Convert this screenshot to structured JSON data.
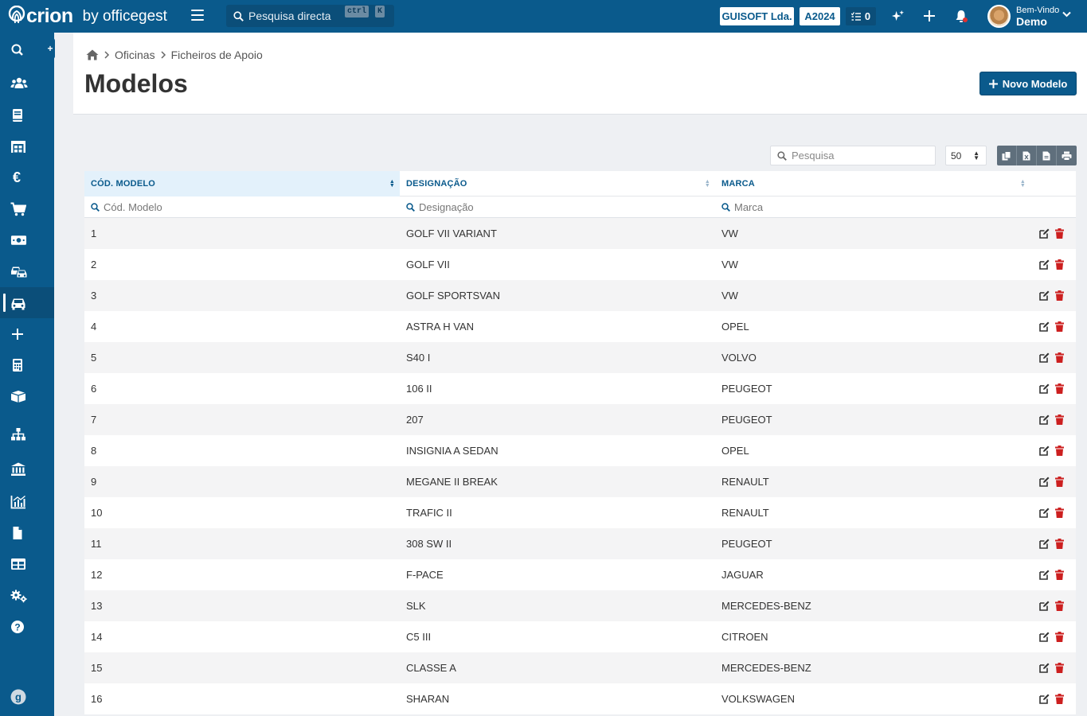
{
  "topbar": {
    "logo_text": "crion",
    "logo_by": "by officegest",
    "search_placeholder": "Pesquisa directa",
    "kbd_ctrl": "ctrl",
    "kbd_k": "K",
    "company": "GUISOFT Lda.",
    "year": "A2024",
    "tasks_count": "0",
    "greeting": "Bem-Vindo",
    "username": "Demo"
  },
  "sidebar": {
    "items": [
      {
        "icon": "search-icon"
      },
      {
        "icon": "users-icon"
      },
      {
        "icon": "book-icon"
      },
      {
        "icon": "warehouse-icon"
      },
      {
        "icon": "euro-icon"
      },
      {
        "icon": "cart-icon"
      },
      {
        "icon": "money-icon"
      },
      {
        "icon": "cars-icon"
      },
      {
        "icon": "car-icon",
        "active": true
      },
      {
        "icon": "plus-icon"
      },
      {
        "icon": "calculator-icon"
      },
      {
        "icon": "box-icon"
      },
      {
        "icon": "sitemap-icon"
      },
      {
        "icon": "bank-icon"
      },
      {
        "icon": "chart-icon"
      },
      {
        "icon": "file-icon"
      },
      {
        "icon": "table-icon"
      },
      {
        "icon": "cogs-icon"
      },
      {
        "icon": "help-icon"
      },
      {
        "icon": "officegest-icon"
      }
    ]
  },
  "breadcrumb": {
    "items": [
      "Oficinas",
      "Ficheiros de Apoio"
    ]
  },
  "page": {
    "title": "Modelos",
    "new_button": "Novo Modelo"
  },
  "tools": {
    "search_placeholder": "Pesquisa",
    "per_page": "50"
  },
  "table": {
    "columns": [
      "CÓD. MODELO",
      "DESIGNAÇÃO",
      "MARCA"
    ],
    "filters": [
      "Cód. Modelo",
      "Designação",
      "Marca"
    ],
    "rows": [
      [
        "1",
        "GOLF VII VARIANT",
        "VW"
      ],
      [
        "2",
        "GOLF VII",
        "VW"
      ],
      [
        "3",
        "GOLF SPORTSVAN",
        "VW"
      ],
      [
        "4",
        "ASTRA H VAN",
        "OPEL"
      ],
      [
        "5",
        "S40 I",
        "VOLVO"
      ],
      [
        "6",
        "106 II",
        "PEUGEOT"
      ],
      [
        "7",
        "207",
        "PEUGEOT"
      ],
      [
        "8",
        "INSIGNIA A SEDAN",
        "OPEL"
      ],
      [
        "9",
        "MEGANE II BREAK",
        "RENAULT"
      ],
      [
        "10",
        "TRAFIC II",
        "RENAULT"
      ],
      [
        "11",
        "308 SW II",
        "PEUGEOT"
      ],
      [
        "12",
        "F-PACE",
        "JAGUAR"
      ],
      [
        "13",
        "SLK",
        "MERCEDES-BENZ"
      ],
      [
        "14",
        "C5 III",
        "CITROEN"
      ],
      [
        "15",
        "CLASSE A",
        "MERCEDES-BENZ"
      ],
      [
        "16",
        "SHARAN",
        "VOLKSWAGEN"
      ]
    ]
  },
  "colors": {
    "brand": "#0a5a8c",
    "delete": "#cc1f1f"
  }
}
